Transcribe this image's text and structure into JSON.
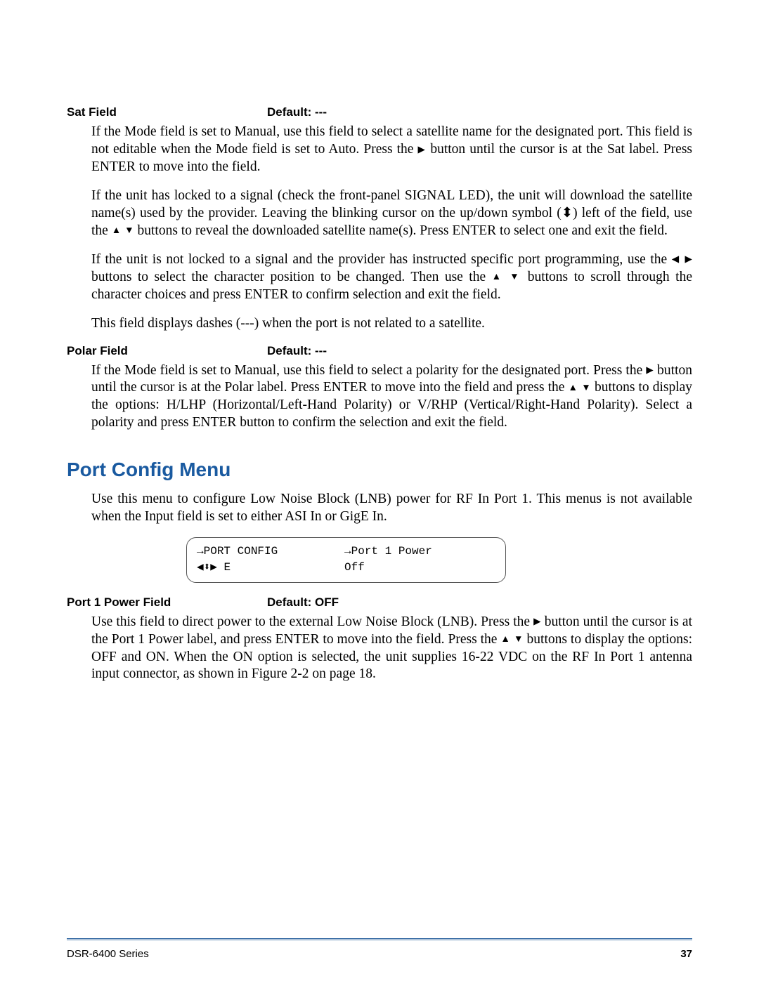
{
  "sections": {
    "sat": {
      "label": "Sat Field",
      "default_label": "Default: ---",
      "p1a": "If the Mode field is set to Manual, use this field to select a satellite name for the designated port. This field is not editable when the Mode field is set to Auto. Press the ",
      "p1b": " button until the cursor is at the Sat label. Press ENTER to move into the field.",
      "p2a": "If the unit has locked to a signal (check the front-panel SIGNAL LED), the unit will download the satellite name(s) used by the provider. Leaving the blinking cursor on the up/down symbol (",
      "p2a_end": ") left of the field, use the ",
      "p2b": " buttons to reveal the downloaded satellite name(s). Press ENTER to select one and exit the field.",
      "p3a": "If the unit is not locked to a signal and the provider has instructed specific port programming, use the ",
      "p3b": " buttons to select the character position to be changed. Then use the ",
      "p3c": " buttons to scroll through the character choices and press ENTER to confirm selection and exit the field.",
      "p4": "This field displays dashes (---) when the port is not related to a satellite."
    },
    "polar": {
      "label": "Polar Field",
      "default_label": "Default: ---",
      "p1a": "If the Mode field is set to Manual, use this field to select a polarity for the designated port. Press the ",
      "p1b": " button until the cursor is at the Polar label. Press ENTER to move into the field and press the ",
      "p1c": " buttons to display the options: H/LHP (Horizontal/Left-Hand Polarity) or V/RHP (Vertical/Right-Hand Polarity). Select a polarity and press ENTER button to confirm the selection and exit the field."
    },
    "portconfig": {
      "heading": "Port Config Menu",
      "intro": "Use this menu to configure Low Noise Block (LNB) power for RF In Port 1. This menus is not available when the Input field is set to either ASI In or GigE In.",
      "lcd": {
        "r1c1": "PORT CONFIG",
        "r1c2": "Port 1 Power",
        "r2c1": " E",
        "r2c2": "Off"
      }
    },
    "port1power": {
      "label": "Port 1 Power Field",
      "default_label": "Default: OFF",
      "p1a": "Use this field to direct power to the external Low Noise Block (LNB). Press the ",
      "p1b": " button until the cursor is at the Port 1 Power label, and press ENTER to move into the field. Press the ",
      "p1c": " buttons to display the options: OFF and ON. When the ON option is selected, the unit supplies 16-22 VDC on the RF In Port 1 antenna input connector, as shown in Figure 2-2 on page 18."
    }
  },
  "footer": {
    "series": "DSR-6400 Series",
    "page": "37"
  }
}
